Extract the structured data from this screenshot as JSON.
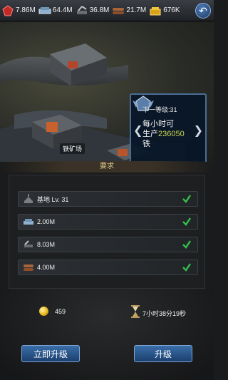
{
  "resources": [
    {
      "icon": "red-gem-icon",
      "value": "7.86M"
    },
    {
      "icon": "steel-icon",
      "value": "64.4M"
    },
    {
      "icon": "oil-icon",
      "value": "36.8M"
    },
    {
      "icon": "wood-icon",
      "value": "21.7M"
    },
    {
      "icon": "gold-icon",
      "value": "676K"
    }
  ],
  "building_panel": {
    "next_level": "下一等级:31",
    "line1": "每小时可",
    "line2_prefix": "生产",
    "production_value": "236050",
    "line3": "铁"
  },
  "building_label": "铁矿场",
  "requirements": {
    "header": "要求",
    "items": [
      {
        "icon": "base-icon",
        "text": "基地 Lv. 31",
        "met": true
      },
      {
        "icon": "steel-icon",
        "text": "2.00M",
        "met": true
      },
      {
        "icon": "oil-icon",
        "text": "8.03M",
        "met": true
      },
      {
        "icon": "wood-icon",
        "text": "4.00M",
        "met": true
      }
    ]
  },
  "cost": {
    "gold_amount": "459",
    "time": "7小时38分19秒"
  },
  "buttons": {
    "instant_upgrade": "立即升级",
    "upgrade": "升级"
  },
  "colors": {
    "accent_blue": "#3b6ea8",
    "production_highlight": "#c9d852",
    "check_green": "#32c24a"
  }
}
